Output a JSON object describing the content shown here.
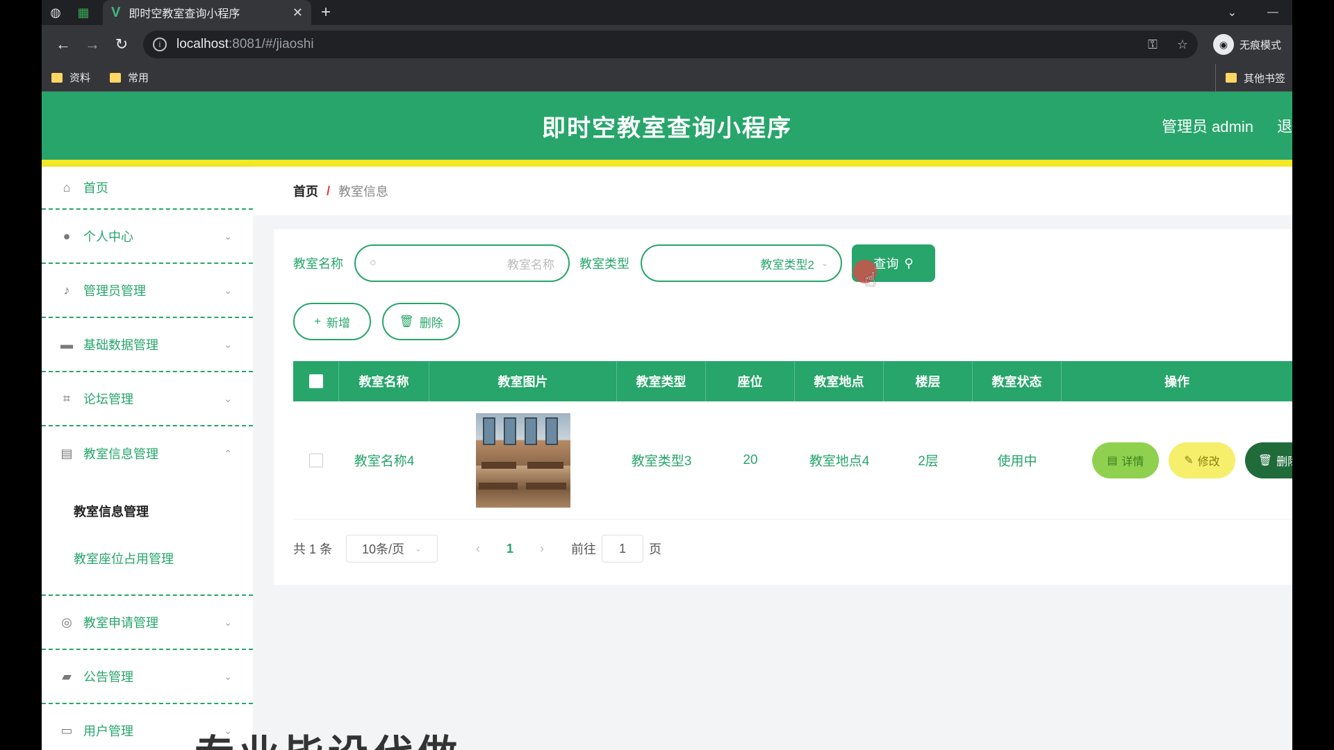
{
  "browser": {
    "tab_title": "即时空教室查询小程序",
    "url_host": "localhost",
    "url_path": ":8081/#/jiaoshi",
    "profile_label": "无痕模式",
    "bookmarks": [
      "资料",
      "常用"
    ],
    "bookmarks_other": "其他书签"
  },
  "header": {
    "title": "即时空教室查询小程序",
    "user": "管理员 admin",
    "logout": "退出"
  },
  "sidebar": {
    "items": [
      {
        "label": "首页",
        "icon": "home-icon"
      },
      {
        "label": "个人中心",
        "icon": "user-icon"
      },
      {
        "label": "管理员管理",
        "icon": "mic-icon"
      },
      {
        "label": "基础数据管理",
        "icon": "briefcase-icon"
      },
      {
        "label": "论坛管理",
        "icon": "crop-icon"
      },
      {
        "label": "教室信息管理",
        "icon": "chat-icon"
      },
      {
        "label": "教室申请管理",
        "icon": "globe-icon"
      },
      {
        "label": "公告管理",
        "icon": "ticket-icon"
      },
      {
        "label": "用户管理",
        "icon": "monitor-icon"
      }
    ],
    "submenu": [
      "教室信息管理",
      "教室座位占用管理"
    ]
  },
  "breadcrumb": {
    "home": "首页",
    "separator": "/",
    "current": "教室信息"
  },
  "search": {
    "name_label": "教室名称",
    "name_placeholder": "教室名称",
    "type_label": "教室类型",
    "type_value": "教室类型2",
    "query_label": "查询"
  },
  "actions": {
    "add_label": "新增",
    "delete_label": "删除"
  },
  "table": {
    "headers": [
      "教室名称",
      "教室图片",
      "教室类型",
      "座位",
      "教室地点",
      "楼层",
      "教室状态",
      "操作"
    ],
    "rows": [
      {
        "name": "教室名称4",
        "type": "教室类型3",
        "seats": "20",
        "location": "教室地点4",
        "floor": "2层",
        "status": "使用中"
      }
    ],
    "op_detail": "详情",
    "op_edit": "修改",
    "op_delete": "删除"
  },
  "pager": {
    "total": "共 1 条",
    "page_size": "10条/页",
    "current": "1",
    "goto_prefix": "前往",
    "goto_value": "1",
    "goto_suffix": "页"
  },
  "overlay_caption": "专业毕设代做",
  "colors": {
    "primary": "#27a56b",
    "stripe": "#f3e826",
    "detail": "#8fd14f",
    "edit": "#f6ef6b",
    "delete": "#1f6b3a"
  }
}
